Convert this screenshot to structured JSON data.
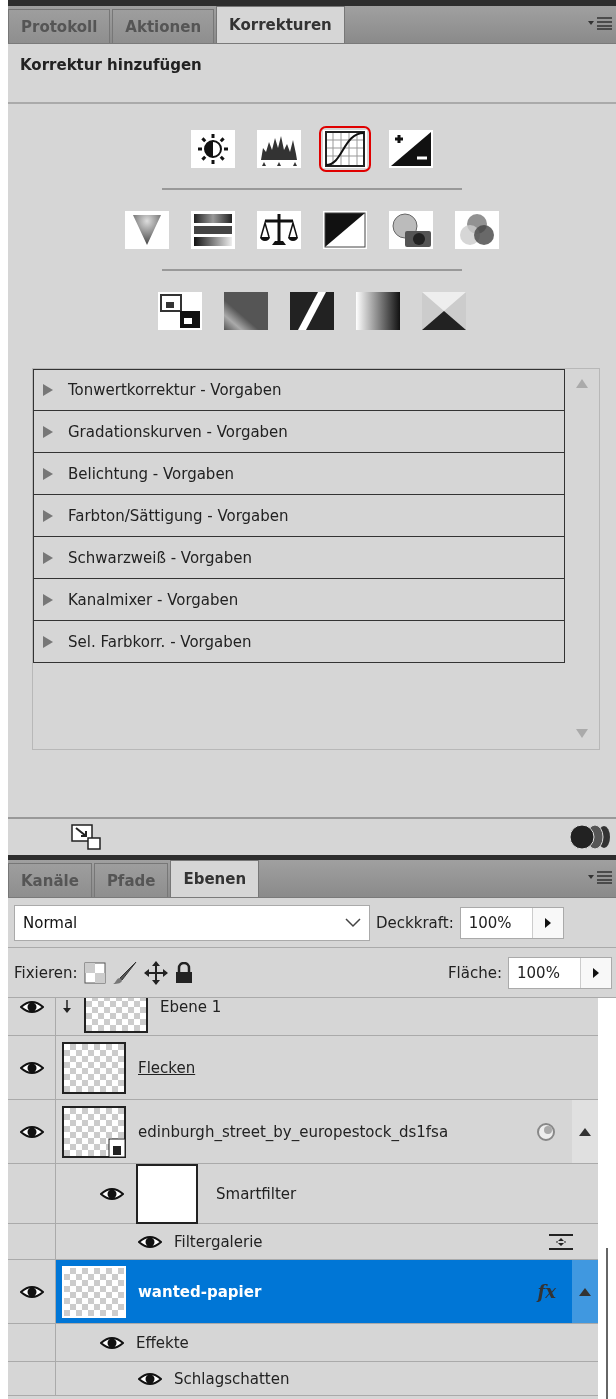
{
  "top_panel": {
    "tabs": [
      {
        "label": "Protokoll",
        "selected": false
      },
      {
        "label": "Aktionen",
        "selected": false
      },
      {
        "label": "Korrekturen",
        "selected": true
      }
    ],
    "heading": "Korrektur hinzufügen",
    "adjustment_rows": [
      [
        {
          "selected": false
        },
        {
          "selected": false
        },
        {
          "selected": true
        },
        {
          "selected": false
        }
      ],
      [
        {
          "selected": false
        },
        {
          "selected": false
        },
        {
          "selected": false
        },
        {
          "selected": false
        },
        {
          "selected": false
        },
        {
          "selected": false
        }
      ],
      [
        {
          "selected": false
        },
        {
          "selected": false
        },
        {
          "selected": false
        },
        {
          "selected": false
        },
        {
          "selected": false
        }
      ]
    ],
    "presets": [
      {
        "label": "Tonwertkorrektur - Vorgaben",
        "expanded": false
      },
      {
        "label": "Gradationskurven - Vorgaben",
        "expanded": false
      },
      {
        "label": "Belichtung - Vorgaben",
        "expanded": false
      },
      {
        "label": "Farbton/Sättigung - Vorgaben",
        "expanded": false
      },
      {
        "label": "Schwarzweiß - Vorgaben",
        "expanded": false
      },
      {
        "label": "Kanalmixer - Vorgaben",
        "expanded": false
      },
      {
        "label": "Sel. Farbkorr. - Vorgaben",
        "expanded": false
      }
    ]
  },
  "layers_panel": {
    "tabs": [
      {
        "label": "Kanäle",
        "selected": false
      },
      {
        "label": "Pfade",
        "selected": false
      },
      {
        "label": "Ebenen",
        "selected": true
      }
    ],
    "blend_mode": "Normal",
    "opacity_label": "Deckkraft:",
    "opacity": "100%",
    "lock_label": "Fixieren:",
    "fill_label": "Fläche:",
    "fill": "100%",
    "layers": [
      {
        "kind": "layer",
        "name": "Ebene 1",
        "visible": true,
        "selected": false,
        "clipped": true,
        "underlined": false,
        "smart_object": false
      },
      {
        "kind": "layer",
        "name": "Flecken",
        "visible": true,
        "selected": false,
        "clipped": false,
        "underlined": true,
        "smart_object": false
      },
      {
        "kind": "layer",
        "name": "edinburgh_street_by_europestock_ds1fsa",
        "visible": true,
        "selected": false,
        "clipped": false,
        "underlined": false,
        "smart_object": true,
        "expanded": true
      },
      {
        "kind": "smartfilter",
        "name": "Smartfilter",
        "visible": true
      },
      {
        "kind": "filter",
        "name": "Filtergalerie",
        "visible": true
      },
      {
        "kind": "layer",
        "name": "wanted-papier",
        "visible": true,
        "selected": true,
        "clipped": false,
        "underlined": false,
        "smart_object": false,
        "fx_label": "fx",
        "expanded": true
      },
      {
        "kind": "effects",
        "name": "Effekte",
        "visible": true
      },
      {
        "kind": "effect",
        "name": "Schlagschatten",
        "visible": true
      }
    ]
  }
}
